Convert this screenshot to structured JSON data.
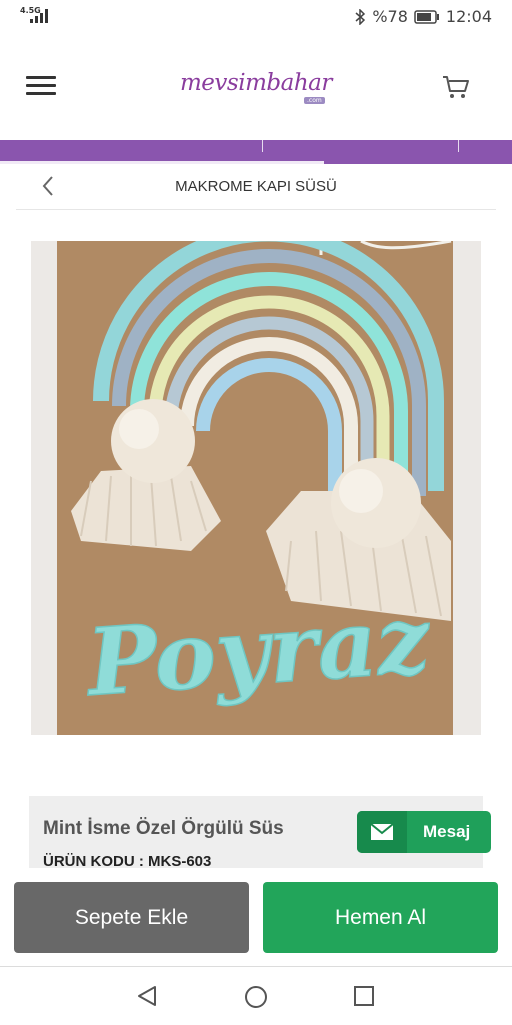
{
  "status_bar": {
    "network": "4.5G",
    "battery_text": "%78",
    "time": "12:04"
  },
  "header": {
    "logo_text": "mevsimbahar",
    "logo_suffix": ".com"
  },
  "breadcrumb": {
    "title": "MAKROME KAPI SÜSÜ"
  },
  "product": {
    "image_caption": "Poyraz",
    "name": "Mint İsme Özel Örgülü Süs",
    "code": "ÜRÜN KODU : MKS-603"
  },
  "actions": {
    "message_label": "Mesaj",
    "add_to_cart_label": "Sepete Ekle",
    "buy_now_label": "Hemen Al"
  },
  "colors": {
    "brand_purple": "#8a55ae",
    "green": "#22a55a",
    "gray_button": "#686868"
  },
  "icons": [
    "menu-icon",
    "cart-icon",
    "back-icon",
    "mail-icon",
    "nav-back-icon",
    "nav-home-icon",
    "nav-recents-icon",
    "bluetooth-icon",
    "battery-icon"
  ]
}
